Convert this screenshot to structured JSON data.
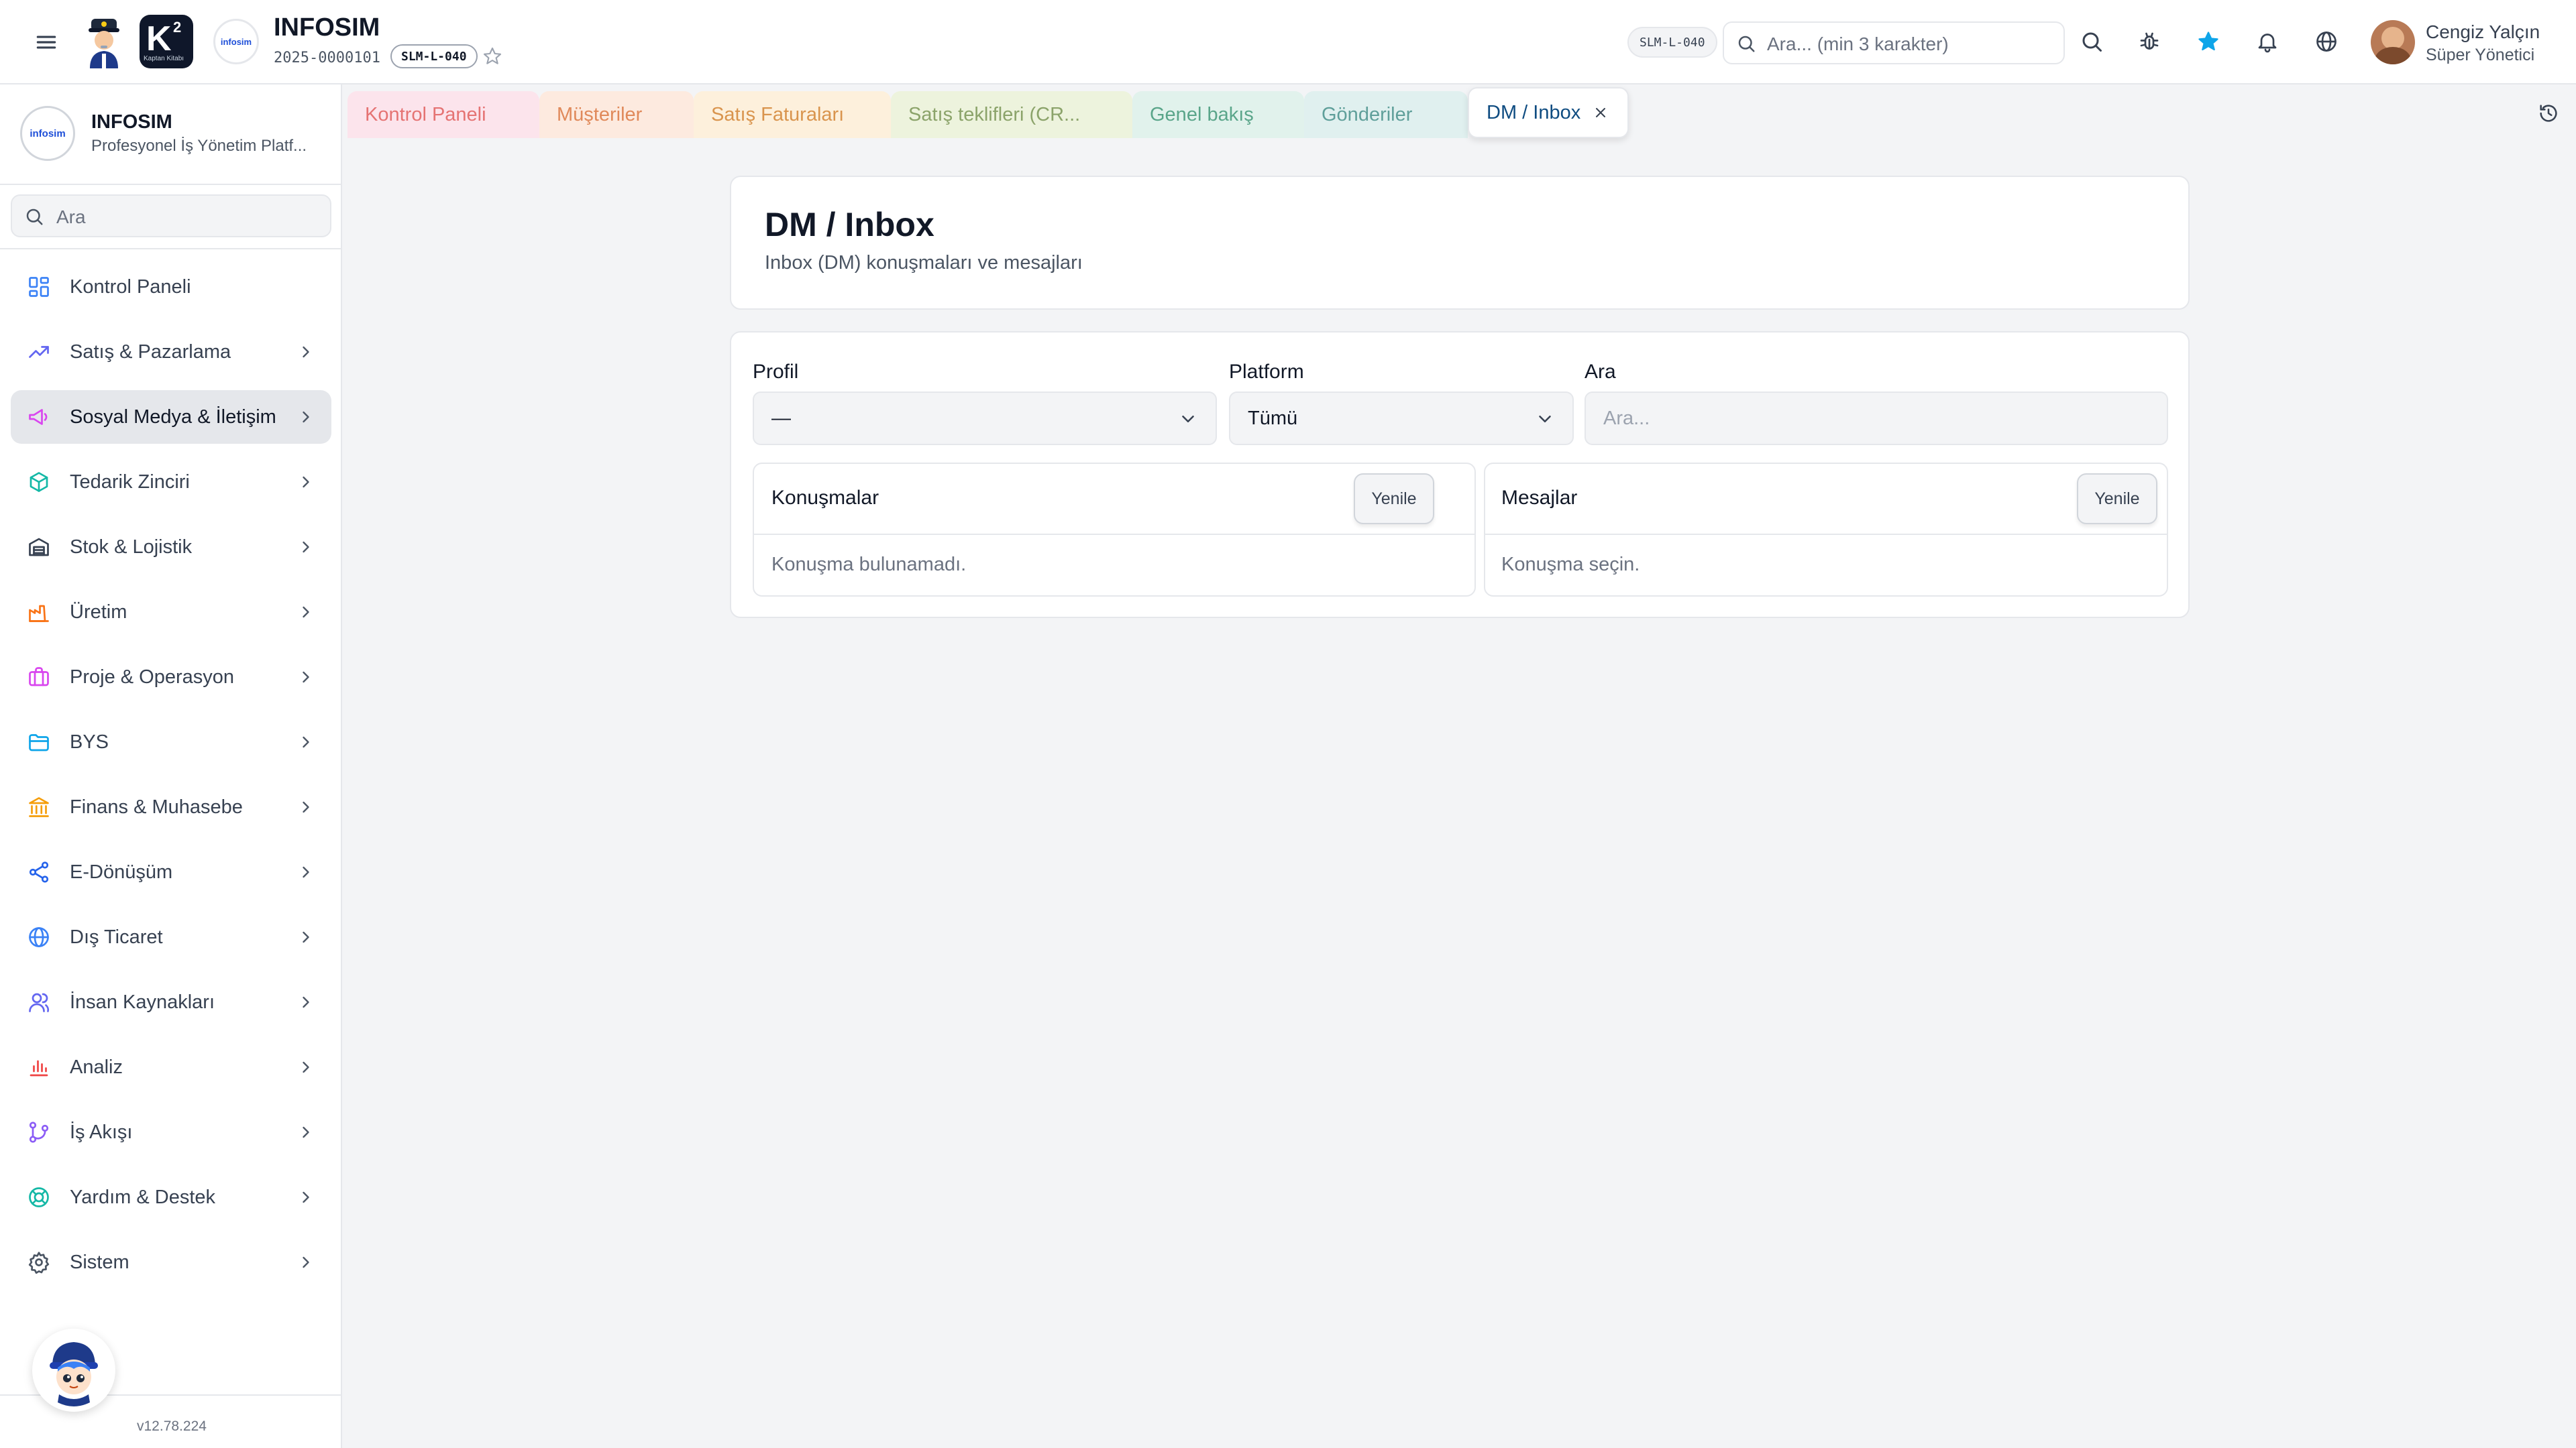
{
  "header": {
    "logo_mark_text": "K",
    "logo_sub_text": "Kaptan Kitabı",
    "company_badge_text": "infosim",
    "company_name": "INFOSIM",
    "company_code": "2025-0000101",
    "license_badge": "SLM-L-040",
    "license_badge_right": "SLM-L-040",
    "search_placeholder": "Ara... (min 3 karakter)",
    "user_name": "Cengiz Yalçın",
    "user_role": "Süper Yönetici"
  },
  "sidebar": {
    "brand_name": "INFOSIM",
    "brand_sub": "Profesyonel İş Yönetim Platf...",
    "search_placeholder": "Ara",
    "items": [
      {
        "label": "Kontrol Paneli",
        "icon": "dashboard-icon",
        "color": "#3b82f6"
      },
      {
        "label": "Satış & Pazarlama",
        "icon": "trending-up-icon",
        "color": "#6366f1"
      },
      {
        "label": "Sosyal Medya & İletişim",
        "icon": "megaphone-icon",
        "color": "#d946ef"
      },
      {
        "label": "Tedarik Zinciri",
        "icon": "box-icon",
        "color": "#14b8a6"
      },
      {
        "label": "Stok & Lojistik",
        "icon": "warehouse-icon",
        "color": "#374151"
      },
      {
        "label": "Üretim",
        "icon": "factory-icon",
        "color": "#f97316"
      },
      {
        "label": "Proje & Operasyon",
        "icon": "briefcase-icon",
        "color": "#d946ef"
      },
      {
        "label": "BYS",
        "icon": "folder-icon",
        "color": "#0ea5e9"
      },
      {
        "label": "Finans & Muhasebe",
        "icon": "bank-icon",
        "color": "#f59e0b"
      },
      {
        "label": "E-Dönüşüm",
        "icon": "share-icon",
        "color": "#2563eb"
      },
      {
        "label": "Dış Ticaret",
        "icon": "globe-icon",
        "color": "#3b82f6"
      },
      {
        "label": "İnsan Kaynakları",
        "icon": "users-icon",
        "color": "#6366f1"
      },
      {
        "label": "Analiz",
        "icon": "bar-chart-icon",
        "color": "#ef4444"
      },
      {
        "label": "İş Akışı",
        "icon": "git-branch-icon",
        "color": "#8b5cf6"
      },
      {
        "label": "Yardım & Destek",
        "icon": "lifebuoy-icon",
        "color": "#14b8a6"
      },
      {
        "label": "Sistem",
        "icon": "gear-icon",
        "color": "#4b5563"
      }
    ],
    "active_index": 2,
    "version": "v12.78.224"
  },
  "tabs": [
    {
      "label": "Kontrol Paneli",
      "bg": "#fce4ec",
      "fg": "#e57373"
    },
    {
      "label": "Müşteriler",
      "bg": "#fdeadf",
      "fg": "#e0895a"
    },
    {
      "label": "Satış Faturaları",
      "bg": "#fdf0dc",
      "fg": "#d9944d"
    },
    {
      "label": "Satış teklifleri (CR...",
      "bg": "#edf3dd",
      "fg": "#8ba36a"
    },
    {
      "label": "Genel bakış",
      "bg": "#e1f2ec",
      "fg": "#5aa58a"
    },
    {
      "label": "Gönderiler",
      "bg": "#e0f0ef",
      "fg": "#5f9f9a"
    },
    {
      "label": "DM / Inbox",
      "bg": "#ffffff",
      "fg": "#0f4c81"
    }
  ],
  "page": {
    "title": "DM / Inbox",
    "subtitle": "Inbox (DM) konuşmaları ve mesajları"
  },
  "filters": {
    "profile_label": "Profil",
    "profile_value": "—",
    "platform_label": "Platform",
    "platform_value": "Tümü",
    "search_label": "Ara",
    "search_placeholder": "Ara..."
  },
  "conversations": {
    "title": "Konuşmalar",
    "refresh_label": "Yenile",
    "empty_text": "Konuşma bulunamadı."
  },
  "messages": {
    "title": "Mesajlar",
    "refresh_label": "Yenile",
    "empty_text": "Konuşma seçin."
  }
}
